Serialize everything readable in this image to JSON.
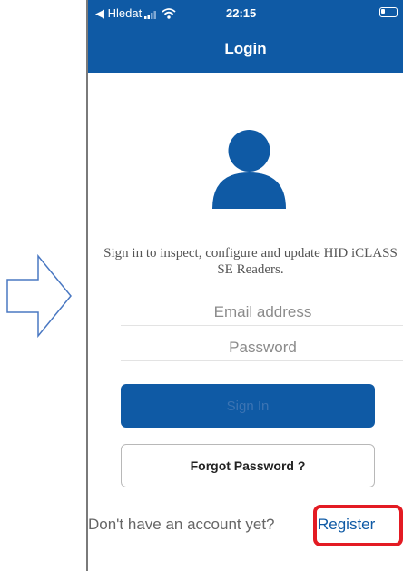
{
  "status_bar": {
    "back_label": "◀ Hledat",
    "time": "22:15"
  },
  "nav": {
    "title": "Login"
  },
  "login": {
    "subtitle": "Sign in to inspect, configure and update HID iCLASS SE Readers.",
    "email_placeholder": "Email address",
    "password_placeholder": "Password",
    "sign_in_label": "Sign In",
    "forgot_label": "Forgot Password ?",
    "no_account_text": "Don't have an account yet?",
    "register_label": "Register"
  },
  "colors": {
    "primary": "#0f5aa5",
    "highlight": "#e31b23",
    "arrow_stroke": "#4a78c2"
  },
  "icons": [
    "right-arrow-outline-icon",
    "signal-icon",
    "wifi-icon",
    "battery-icon",
    "user-avatar-icon"
  ]
}
